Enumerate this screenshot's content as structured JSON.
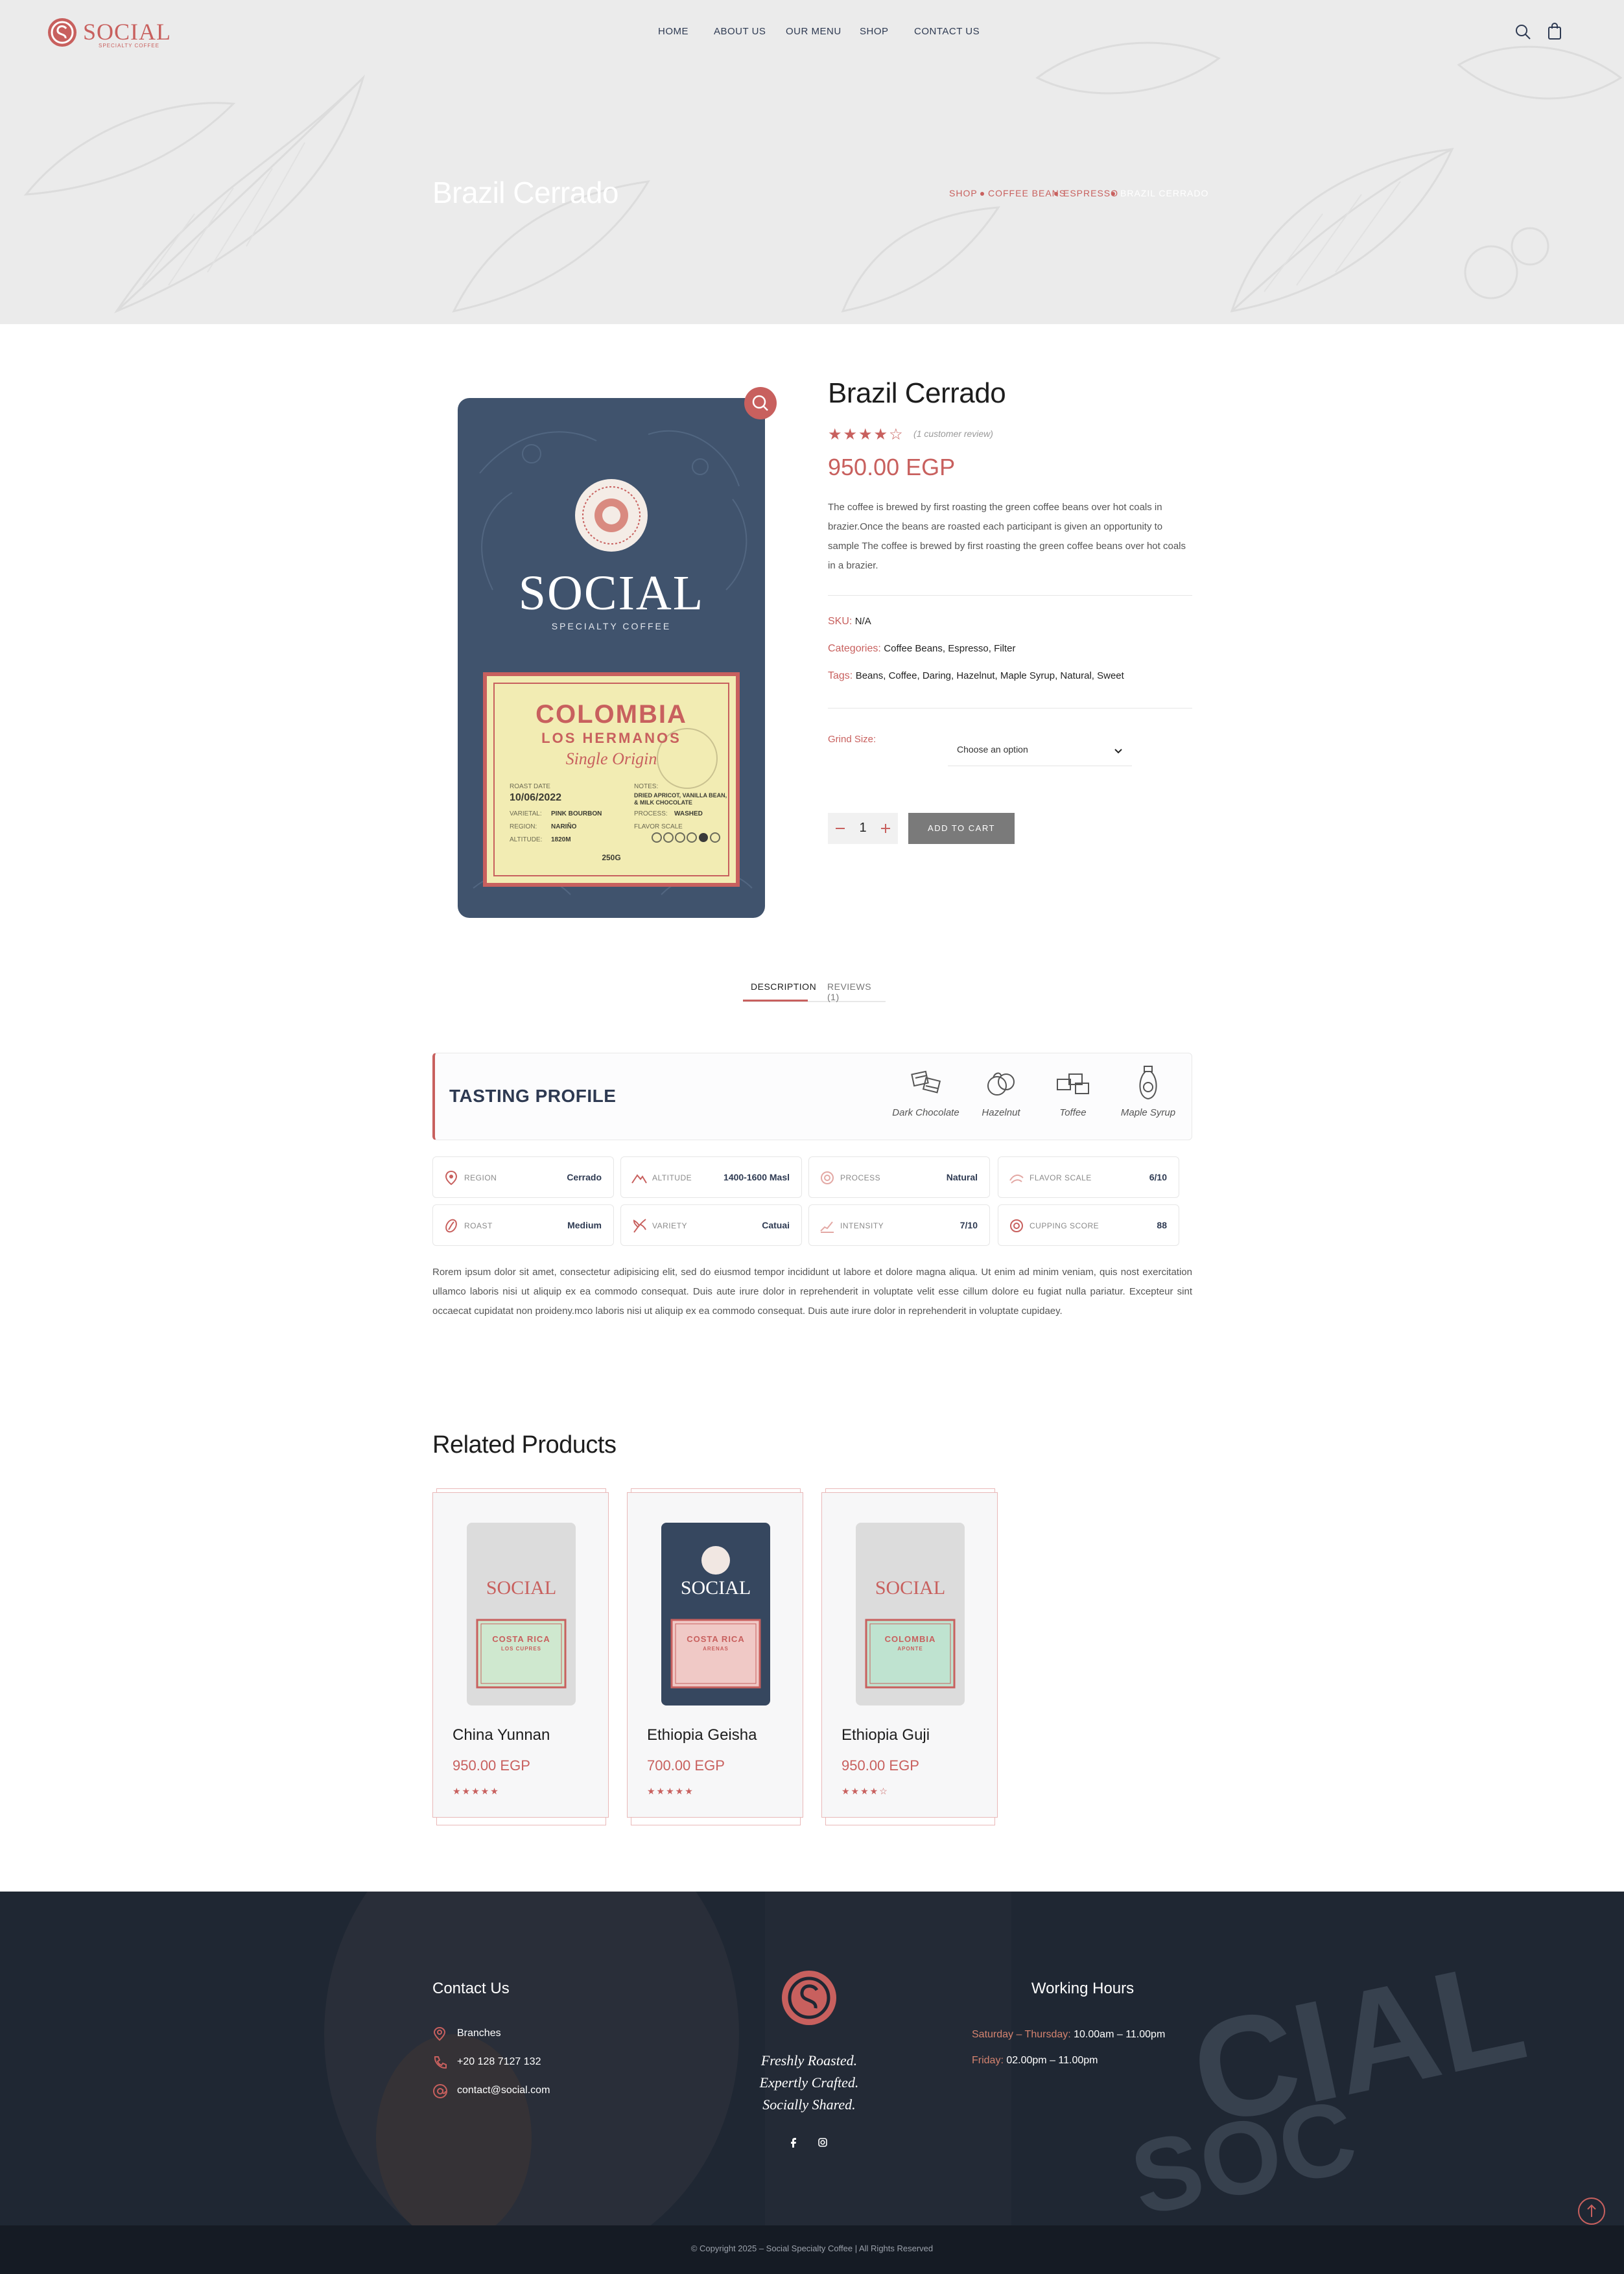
{
  "brand": {
    "name": "SOCIAL",
    "tagline": "SPECIALTY COFFEE",
    "accent": "#c8605e",
    "navy": "#2e3a52"
  },
  "nav": {
    "items": [
      "HOME",
      "ABOUT US",
      "OUR MENU",
      "SHOP",
      "CONTACT US"
    ],
    "search_icon": "search-icon",
    "cart_icon": "shopping-bag-icon"
  },
  "hero": {
    "title": "Brazil Cerrado",
    "breadcrumb": [
      "SHOP",
      "COFFEE BEANS",
      "ESPRESSO",
      "BRAZIL CERRADO"
    ]
  },
  "product": {
    "title": "Brazil Cerrado",
    "rating": 4,
    "rating_max": 5,
    "review_text": "(1 customer review)",
    "price": "950.00 EGP",
    "description": "The coffee is brewed by first roasting the green coffee beans over hot coals in brazier.Once the beans are roasted each participant is given an opportunity to sample The coffee is brewed by first roasting the green coffee beans over hot coals in a brazier.",
    "sku_label": "SKU:",
    "sku_value": "N/A",
    "categories_label": "Categories:",
    "categories_value": "Coffee Beans, Espresso, Filter",
    "tags_label": "Tags:",
    "tags_value": "Beans, Coffee, Daring, Hazelnut, Maple Syrup, Natural, Sweet",
    "grind_label": "Grind Size:",
    "grind_placeholder": "Choose an option",
    "quantity": "1",
    "add_to_cart": "ADD TO CART",
    "bag": {
      "brand": "SOCIAL",
      "sub": "SPECIALTY COFFEE",
      "origin": "COLOMBIA",
      "farm": "LOS HERMANOS",
      "script": "Single Origin",
      "roast_date_label": "ROAST DATE",
      "roast_date": "10/06/2022",
      "notes_label": "NOTES:",
      "notes": "DRIED APRICOT, VANILLA BEAN, & MILK CHOCOLATE",
      "varietal_label": "VARIETAL:",
      "varietal": "PINK BOURBON",
      "process_label": "PROCESS:",
      "process": "WASHED",
      "region_label": "REGION:",
      "region": "NARIÑO",
      "flavor_label": "FLAVOR SCALE",
      "altitude_label": "ALTITUDE:",
      "altitude": "1820M",
      "weight": "250G"
    }
  },
  "tabs": {
    "items": [
      "DESCRIPTION",
      "REVIEWS (1)"
    ],
    "active": 0
  },
  "tasting": {
    "title": "TASTING PROFILE",
    "notes": [
      {
        "label": "Dark Chocolate",
        "icon": "chocolate-icon"
      },
      {
        "label": "Hazelnut",
        "icon": "hazelnut-icon"
      },
      {
        "label": "Toffee",
        "icon": "toffee-icon"
      },
      {
        "label": "Maple Syrup",
        "icon": "maple-syrup-icon"
      }
    ]
  },
  "specs": [
    {
      "key": "REGION",
      "value": "Cerrado",
      "icon": "map-pin-icon"
    },
    {
      "key": "ALTITUDE",
      "value": "1400-1600 Masl",
      "icon": "mountain-icon"
    },
    {
      "key": "PROCESS",
      "value": "Natural",
      "icon": "process-icon"
    },
    {
      "key": "FLAVOR SCALE",
      "value": "6/10",
      "icon": "flavor-icon"
    },
    {
      "key": "ROAST",
      "value": "Medium",
      "icon": "bean-icon"
    },
    {
      "key": "VARIETY",
      "value": "Catuai",
      "icon": "plant-icon"
    },
    {
      "key": "INTENSITY",
      "value": "7/10",
      "icon": "chart-icon"
    },
    {
      "key": "CUPPING SCORE",
      "value": "88",
      "icon": "badge-icon"
    }
  ],
  "body_text": "Rorem ipsum dolor sit amet, consectetur adipisicing elit, sed do eiusmod tempor incididunt ut labore et dolore magna aliqua. Ut enim ad minim veniam, quis nost exercitation ullamco laboris nisi ut aliquip ex ea commodo consequat. Duis aute irure dolor in reprehenderit in voluptate velit esse cillum dolore eu fugiat nulla pariatur. Excepteur sint occaecat cupidatat non proideny.mco laboris nisi ut aliquip ex ea commodo consequat. Duis aute irure dolor in reprehenderit in voluptate cupidaey.",
  "related": {
    "title": "Related Products",
    "items": [
      {
        "name": "China Yunnan",
        "price": "950.00 EGP",
        "stars": "★★★★★",
        "bag_color": "#dcdcdc",
        "label_color": "#cfe8cf",
        "origin": "COSTA RICA",
        "farm": "LOS CUPRES",
        "logo_color": "#c8605e"
      },
      {
        "name": "Ethiopia Geisha",
        "price": "700.00 EGP",
        "stars": "★★★★★",
        "bag_color": "#36475f",
        "label_color": "#f0c9c6",
        "origin": "COSTA RICA",
        "farm": "ARENAS",
        "logo_color": "#ffffff"
      },
      {
        "name": "Ethiopia Guji",
        "price": "950.00 EGP",
        "stars": "★★★★☆",
        "bag_color": "#dcdcdc",
        "label_color": "#bfe3d0",
        "origin": "COLOMBIA",
        "farm": "APONTE",
        "logo_color": "#c8605e"
      }
    ]
  },
  "footer": {
    "contact_title": "Contact Us",
    "contact": [
      {
        "icon": "map-pin-icon",
        "text": "Branches"
      },
      {
        "icon": "phone-icon",
        "text": "+20 128 7127 132"
      },
      {
        "icon": "at-icon",
        "text": "contact@social.com"
      }
    ],
    "slogan": [
      "Freshly Roasted.",
      "Expertly Crafted.",
      "Socially Shared."
    ],
    "hours_title": "Working Hours",
    "hours": [
      {
        "days": "Saturday – Thursday:",
        "time": "10.00am – 11.00pm"
      },
      {
        "days": "Friday:",
        "time": "02.00pm – 11.00pm"
      }
    ],
    "social": [
      "facebook-icon",
      "instagram-icon"
    ],
    "copyright": "© Copyright 2025 – Social Specialty Coffee | All Rights Reserved"
  }
}
